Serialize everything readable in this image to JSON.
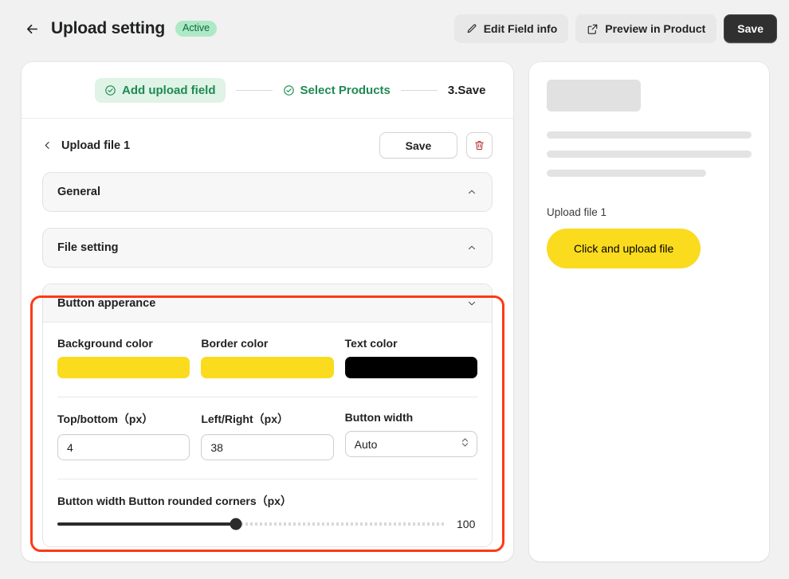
{
  "header": {
    "back_icon": "arrow-left-icon",
    "title": "Upload setting",
    "status_badge": "Active",
    "edit_field_label": "Edit Field info",
    "preview_label": "Preview in Product",
    "save_label": "Save"
  },
  "stepper": {
    "steps": [
      {
        "label": "Add upload field",
        "state": "done"
      },
      {
        "label": "Select Products",
        "state": "done"
      },
      {
        "label": "3.Save",
        "state": "pending"
      }
    ]
  },
  "field_header": {
    "title": "Upload file 1",
    "save_label": "Save",
    "delete_icon": "trash-icon"
  },
  "sections": [
    {
      "title": "General",
      "expanded": false
    },
    {
      "title": "File setting",
      "expanded": false
    }
  ],
  "button_appearance": {
    "title": "Button apperance",
    "background_color": {
      "label": "Background color",
      "value": "#FADB1E"
    },
    "border_color": {
      "label": "Border color",
      "value": "#FADB1E"
    },
    "text_color": {
      "label": "Text color",
      "value": "#000000"
    },
    "top_bottom": {
      "label": "Top/bottom（px）",
      "value": "4"
    },
    "left_right": {
      "label": "Left/Right（px）",
      "value": "38"
    },
    "button_width": {
      "label": "Button width",
      "value": "Auto"
    },
    "rounded_corners": {
      "label": "Button width Button rounded corners（px）",
      "value": "100",
      "min": 0,
      "max": 200,
      "fill_percent": 46
    }
  },
  "preview": {
    "upload_label": "Upload file 1",
    "button_text": "Click and upload file",
    "button_bg": "#FADB1E",
    "button_text_color": "#000000",
    "button_radius_px": "100"
  },
  "colors": {
    "accent_red_highlight": "#FC3A14",
    "page_bg": "#F1F1F1",
    "green": "#1F8A53",
    "badge_bg": "#AEE9C6",
    "trash_red": "#B3252B"
  }
}
